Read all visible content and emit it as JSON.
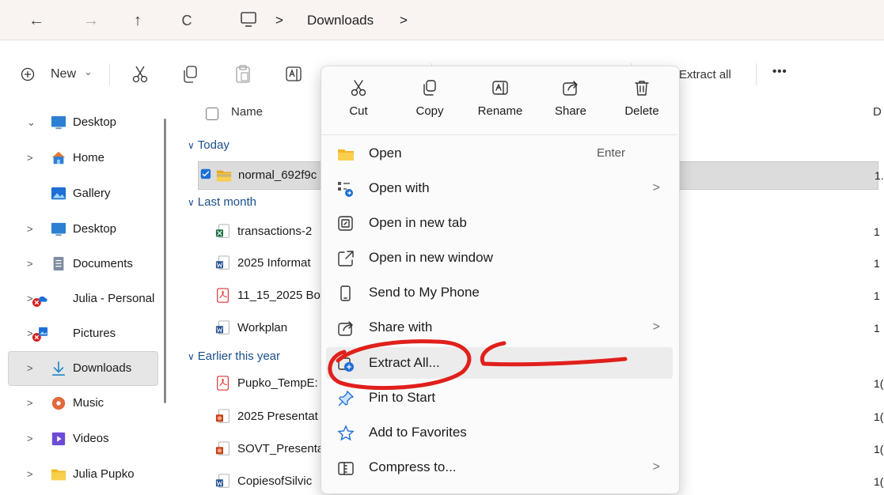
{
  "address": {
    "back_glyph": "←",
    "forward_glyph": "→",
    "up_glyph": "↑",
    "refresh_glyph": "C",
    "sep1": ">",
    "folder": "Downloads",
    "sep2": ">"
  },
  "toolbar": {
    "new_label": "New",
    "new_caret": "⌄",
    "extract_all_label": "Extract all",
    "more_label": "•••"
  },
  "sidebar": {
    "items": [
      {
        "chev": "⌄",
        "label": "Desktop",
        "icon": "desktop-icon"
      },
      {
        "chev": ">",
        "label": "Home",
        "icon": "home-icon"
      },
      {
        "chev": "",
        "label": "Gallery",
        "icon": "gallery-icon"
      },
      {
        "chev": ">",
        "label": "Desktop",
        "icon": "desktop-icon"
      },
      {
        "chev": ">",
        "label": "Documents",
        "icon": "documents-icon"
      },
      {
        "chev": ">",
        "label": "Julia - Personal",
        "icon": "onedrive-icon"
      },
      {
        "chev": ">",
        "label": "Pictures",
        "icon": "pictures-icon"
      },
      {
        "chev": ">",
        "label": "Downloads",
        "icon": "downloads-icon"
      },
      {
        "chev": ">",
        "label": "Music",
        "icon": "music-icon"
      },
      {
        "chev": ">",
        "label": "Videos",
        "icon": "videos-icon"
      },
      {
        "chev": ">",
        "label": "Julia Pupko",
        "icon": "folder-icon"
      }
    ]
  },
  "list": {
    "name_header": "Name",
    "date_header": "D",
    "groups": {
      "today": "Today",
      "last_month": "Last month",
      "earlier": "Earlier this year"
    },
    "files": [
      {
        "name": "normal_692f9c",
        "date": "1.",
        "type": "zip"
      },
      {
        "name": "transactions-2",
        "date": "1",
        "type": "excel"
      },
      {
        "name": "2025 Informat",
        "date": "1",
        "type": "word"
      },
      {
        "name": "11_15_2025 Bo",
        "date": "1",
        "type": "pdf"
      },
      {
        "name": "Workplan",
        "date": "1",
        "type": "word"
      },
      {
        "name": "Pupko_TempE:",
        "date": "1(",
        "type": "pdf"
      },
      {
        "name": "2025 Presentat",
        "date": "1(",
        "type": "ppt"
      },
      {
        "name": "SOVT_Presenta",
        "date": "1(",
        "type": "ppt"
      },
      {
        "name": "CopiesofSilvic",
        "date": "1(",
        "type": "word"
      }
    ]
  },
  "context_menu": {
    "quick_actions": [
      {
        "label": "Cut",
        "icon": "cut-icon"
      },
      {
        "label": "Copy",
        "icon": "copy-icon"
      },
      {
        "label": "Rename",
        "icon": "rename-icon"
      },
      {
        "label": "Share",
        "icon": "share-icon"
      },
      {
        "label": "Delete",
        "icon": "delete-icon"
      }
    ],
    "items": [
      {
        "label": "Open",
        "shortcut": "Enter",
        "arrow": "",
        "icon": "open-folder-icon"
      },
      {
        "label": "Open with",
        "shortcut": "",
        "arrow": ">",
        "icon": "open-with-icon"
      },
      {
        "label": "Open in new tab",
        "shortcut": "",
        "arrow": "",
        "icon": "new-tab-icon"
      },
      {
        "label": "Open in new window",
        "shortcut": "",
        "arrow": "",
        "icon": "new-window-icon"
      },
      {
        "label": "Send to My Phone",
        "shortcut": "",
        "arrow": "",
        "icon": "phone-icon"
      },
      {
        "label": "Share with",
        "shortcut": "",
        "arrow": ">",
        "icon": "share-with-icon"
      },
      {
        "label": "Extract All...",
        "shortcut": "",
        "arrow": "",
        "icon": "extract-icon"
      },
      {
        "label": "Pin to Start",
        "shortcut": "",
        "arrow": "",
        "icon": "pin-icon"
      },
      {
        "label": "Add to Favorites",
        "shortcut": "",
        "arrow": "",
        "icon": "star-icon"
      },
      {
        "label": "Compress to...",
        "shortcut": "",
        "arrow": ">",
        "icon": "compress-icon"
      }
    ]
  },
  "colors": {
    "annotation": "#e0201b",
    "accent": "#0067c0"
  }
}
